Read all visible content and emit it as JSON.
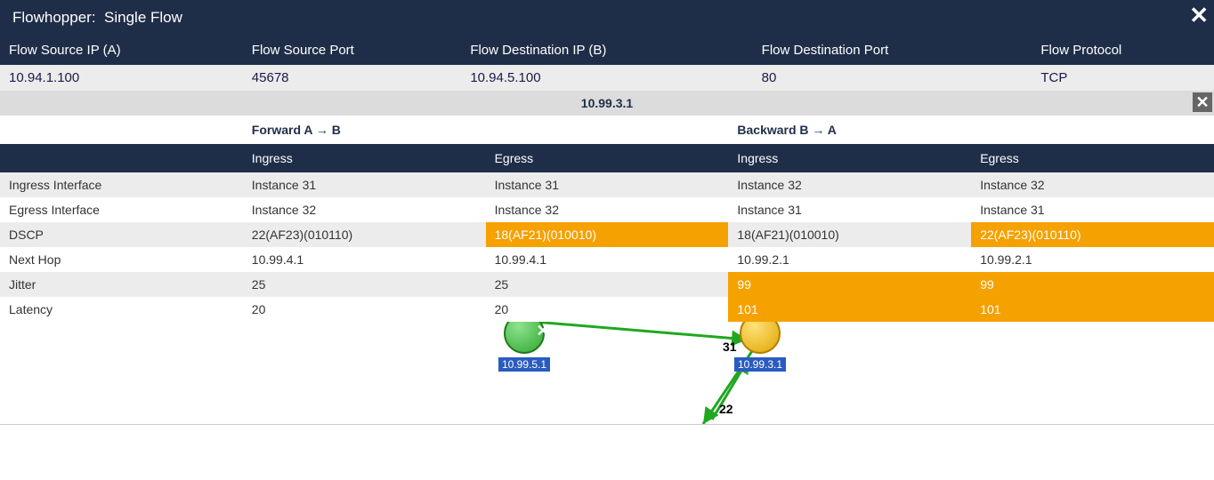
{
  "header": {
    "title_prefix": "Flowhopper:",
    "title_mode": "Single Flow"
  },
  "flow_headers": {
    "src_ip": "Flow Source IP (A)",
    "src_port": "Flow Source Port",
    "dst_ip": "Flow Destination IP (B)",
    "dst_port": "Flow Destination Port",
    "proto": "Flow Protocol"
  },
  "flow": {
    "src_ip": "10.94.1.100",
    "src_port": "45678",
    "dst_ip": "10.94.5.100",
    "dst_port": "80",
    "proto": "TCP"
  },
  "node": {
    "ip": "10.99.3.1"
  },
  "directions": {
    "forward": "Forward A → B",
    "backward": "Backward B → A",
    "ingress": "Ingress",
    "egress": "Egress"
  },
  "metrics_labels": {
    "ing_if": "Ingress Interface",
    "eg_if": "Egress Interface",
    "dscp": "DSCP",
    "next": "Next Hop",
    "jitter": "Jitter",
    "latency": "Latency"
  },
  "metrics": {
    "ing_if": {
      "f_in": "Instance 31",
      "f_out": "Instance 31",
      "b_in": "Instance 32",
      "b_out": "Instance 32"
    },
    "eg_if": {
      "f_in": "Instance 32",
      "f_out": "Instance 32",
      "b_in": "Instance 31",
      "b_out": "Instance 31"
    },
    "dscp": {
      "f_in": "22(AF23)(010110)",
      "f_out": "18(AF21)(010010)",
      "b_in": "18(AF21)(010010)",
      "b_out": "22(AF23)(010110)"
    },
    "next": {
      "f_in": "10.99.4.1",
      "f_out": "10.99.4.1",
      "b_in": "10.99.2.1",
      "b_out": "10.99.2.1"
    },
    "jitter": {
      "f_in": "25",
      "f_out": "25",
      "b_in": "99",
      "b_out": "99"
    },
    "latency": {
      "f_in": "20",
      "f_out": "20",
      "b_in": "101",
      "b_out": "101"
    }
  },
  "topology": {
    "node1": {
      "label": "10.99.5.1",
      "color": "green"
    },
    "node2": {
      "label": "10.99.3.1",
      "color": "yellow",
      "port": "31",
      "metric": "22"
    }
  }
}
